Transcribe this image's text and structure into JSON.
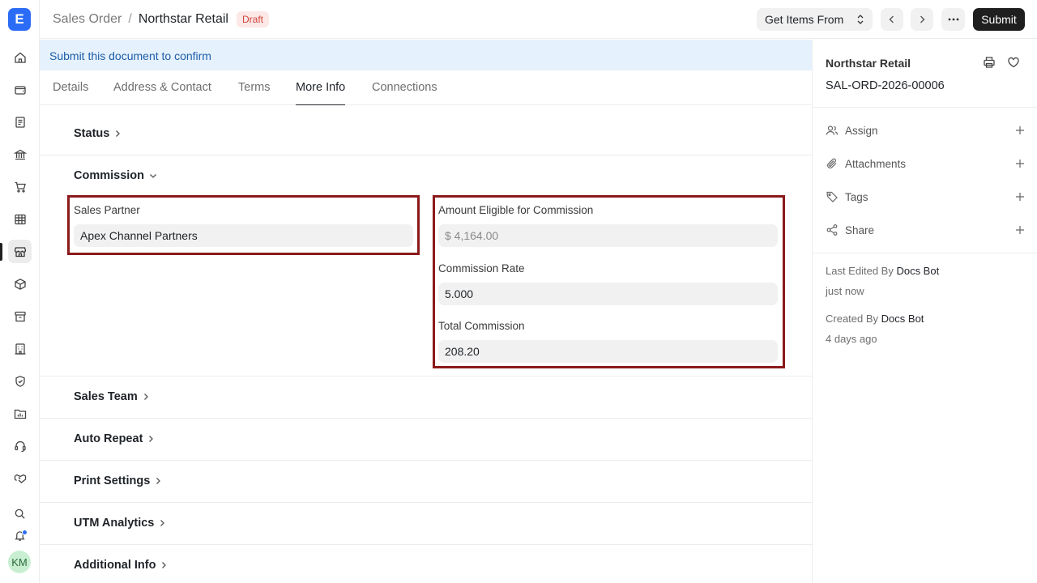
{
  "app": {
    "logo_letter": "E",
    "user_initials": "KM"
  },
  "rail": {
    "icons": [
      "home-icon",
      "wallet-icon",
      "document-icon",
      "bank-icon",
      "cart-icon",
      "table-icon",
      "store-icon",
      "box-icon",
      "archive-icon",
      "building-icon",
      "shield-icon",
      "folder-chart-icon",
      "headset-icon",
      "handshake-icon"
    ],
    "active": "store-icon",
    "bottom_icons": [
      "search-icon",
      "bell-icon"
    ]
  },
  "header": {
    "breadcrumb_parent": "Sales Order",
    "breadcrumb_separator": "/",
    "breadcrumb_current": "Northstar Retail",
    "status_badge": "Draft",
    "get_items_label": "Get Items From",
    "submit_label": "Submit"
  },
  "banner": {
    "text": "Submit this document to confirm"
  },
  "tabs": [
    {
      "label": "Details"
    },
    {
      "label": "Address & Contact"
    },
    {
      "label": "Terms"
    },
    {
      "label": "More Info",
      "active": true
    },
    {
      "label": "Connections"
    }
  ],
  "sections": {
    "status": "Status",
    "commission": "Commission",
    "sales_team": "Sales Team",
    "auto_repeat": "Auto Repeat",
    "print_settings": "Print Settings",
    "utm_analytics": "UTM Analytics",
    "additional_info": "Additional Info"
  },
  "commission": {
    "sales_partner_label": "Sales Partner",
    "sales_partner_value": "Apex Channel Partners",
    "amount_eligible_label": "Amount Eligible for Commission",
    "amount_eligible_value": "$ 4,164.00",
    "commission_rate_label": "Commission Rate",
    "commission_rate_value": "5.000",
    "total_commission_label": "Total Commission",
    "total_commission_value": "208.20"
  },
  "sidebar": {
    "title": "Northstar Retail",
    "doc_id": "SAL-ORD-2026-00006",
    "actions": [
      {
        "label": "Assign",
        "icon": "users-icon"
      },
      {
        "label": "Attachments",
        "icon": "paperclip-icon"
      },
      {
        "label": "Tags",
        "icon": "tag-icon"
      },
      {
        "label": "Share",
        "icon": "share-icon"
      }
    ],
    "last_edited_prefix": "Last Edited By",
    "last_edited_by": "Docs Bot",
    "last_edited_time": "just now",
    "created_prefix": "Created By",
    "created_by": "Docs Bot",
    "created_time": "4 days ago"
  },
  "colors": {
    "accent": "#2b6cf6",
    "highlight_border": "#8b1a1a",
    "banner_bg": "#e5f1fd",
    "draft_badge": "#d0453b"
  }
}
